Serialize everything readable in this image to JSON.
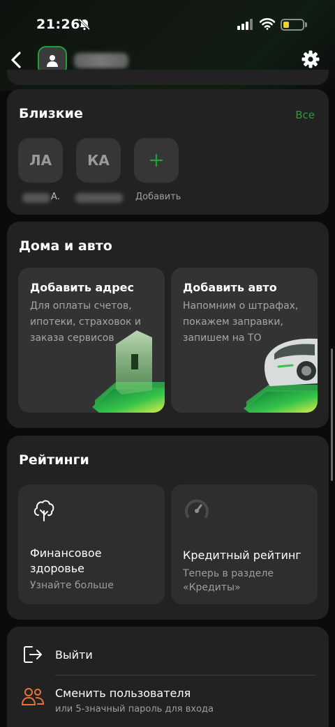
{
  "status_bar": {
    "time": "21:26"
  },
  "header": {
    "icons": [
      "back-arrow-icon",
      "person-icon",
      "gear-icon"
    ]
  },
  "close_people": {
    "title": "Близкие",
    "all_link": "Все",
    "items": [
      {
        "initials": "ЛА",
        "caption": "А."
      },
      {
        "initials": "КА",
        "caption": ""
      },
      {
        "initials": "+",
        "caption": "Добавить"
      }
    ]
  },
  "homes_auto": {
    "title": "Дома и авто",
    "cards": [
      {
        "title": "Добавить адрес",
        "description": "Для оплаты счетов,\nипотеки, страховок и\nзаказа сервисов"
      },
      {
        "title": "Добавить авто",
        "description": "Напомним о штрафах,\nпокажем заправки,\nзапишем на ТО"
      }
    ]
  },
  "ratings": {
    "title": "Рейтинги",
    "cards": [
      {
        "icon": "tree-icon",
        "title": "Финансовое\nздоровье",
        "subtitle": "Узнайте больше"
      },
      {
        "icon": "gauge-icon",
        "title": "Кредитный рейтинг",
        "subtitle": "Теперь в разделе\n«Кредиты»"
      }
    ]
  },
  "menu": {
    "items": [
      {
        "icon": "logout-icon",
        "label": "Выйти",
        "sub": ""
      },
      {
        "icon": "users-icon",
        "label": "Сменить пользователя",
        "sub": "или 5-значный пароль для входа"
      }
    ]
  },
  "colors": {
    "accent": "#21a038",
    "background": "#0b0b0b",
    "card": "#222222",
    "tile": "#333333",
    "orange": "#e8733a"
  }
}
